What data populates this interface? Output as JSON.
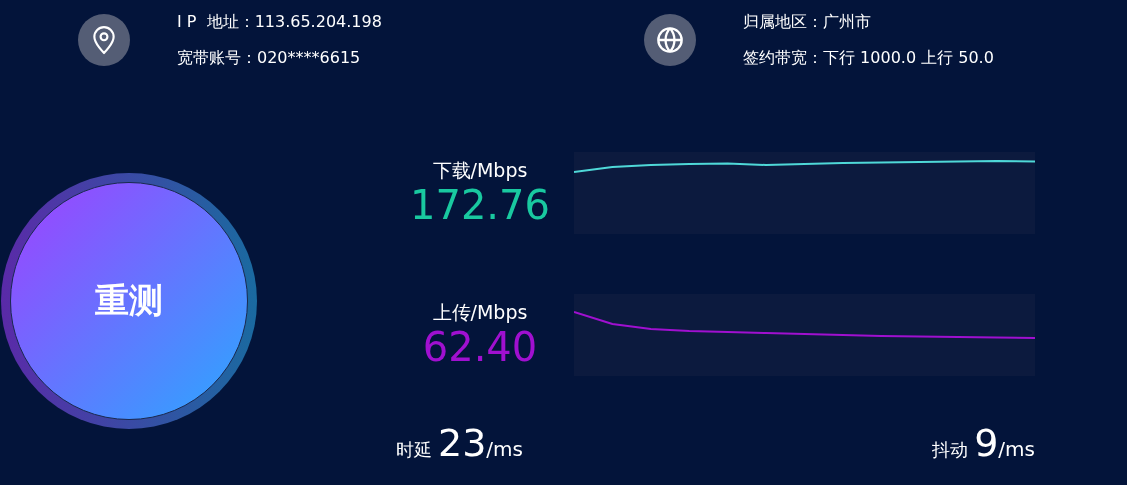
{
  "info_groups": [
    {
      "kind": "location",
      "lines": [
        "I P  地址：113.65.204.198",
        "宽带账号：020****6615"
      ]
    },
    {
      "kind": "globe",
      "lines": [
        "归属地区：广州市",
        "签约带宽：下行 1000.0 上行 50.0"
      ]
    }
  ],
  "retest_button": {
    "label": "重测"
  },
  "metrics": [
    {
      "label": "下载/Mbps",
      "value": "172.76",
      "color": "#19c9a0",
      "kind": "steady"
    },
    {
      "label": "上传/Mbps",
      "value": "62.40",
      "color": "#a010d0",
      "kind": "declining"
    }
  ],
  "footer": [
    {
      "label": "时延",
      "value": "23",
      "unit": "/ms"
    },
    {
      "label": "抖动",
      "value": "9",
      "unit": "/ms"
    }
  ]
}
